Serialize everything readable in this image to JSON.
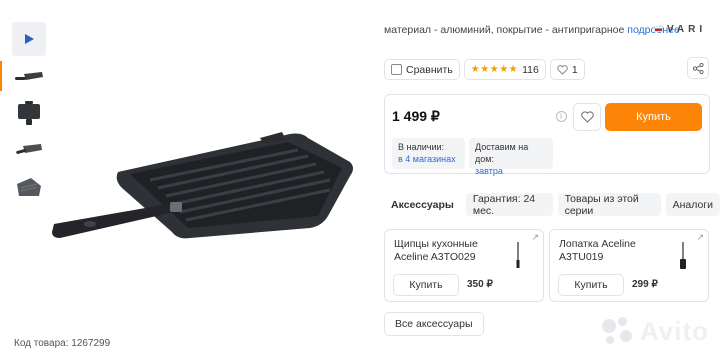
{
  "thumbnails": [
    {
      "kind": "video",
      "icon": "play-icon"
    },
    {
      "kind": "image",
      "label": "pan-thumbnail-1"
    },
    {
      "kind": "image",
      "label": "pan-thumbnail-2"
    },
    {
      "kind": "image",
      "label": "pan-thumbnail-3"
    },
    {
      "kind": "image",
      "label": "pan-thumbnail-4"
    }
  ],
  "product": {
    "code": "Код товара: 1267299",
    "attributes": "материал - алюминий, покрытие - антипригарное",
    "more_link": "подробнее",
    "brand": "VARI"
  },
  "actions": {
    "compare_label": "Сравнить",
    "rating_count": "116",
    "likes": "1"
  },
  "price_box": {
    "price": "1 499 ₽",
    "buy_label": "Купить",
    "availability_title": "В наличии:",
    "availability_link": "в 4 магазинах",
    "delivery_title": "Доставим на дом:",
    "delivery_value": "завтра"
  },
  "tabs": [
    "Аксессуары",
    "Гарантия: 24 мес.",
    "Товары из этой серии",
    "Аналоги"
  ],
  "accessories": [
    {
      "name_line1": "Щипцы кухонные",
      "name_line2": "Aceline A3TO029",
      "buy_label": "Купить",
      "price": "350 ₽"
    },
    {
      "name_line1": "Лопатка Aceline",
      "name_line2": "A3TU019",
      "buy_label": "Купить",
      "price": "299 ₽"
    }
  ],
  "all_accessories_label": "Все аксессуары",
  "watermark": "Avito",
  "colors": {
    "accent": "#fc8507",
    "link": "#2b6cd8",
    "star": "#f0a00a"
  }
}
